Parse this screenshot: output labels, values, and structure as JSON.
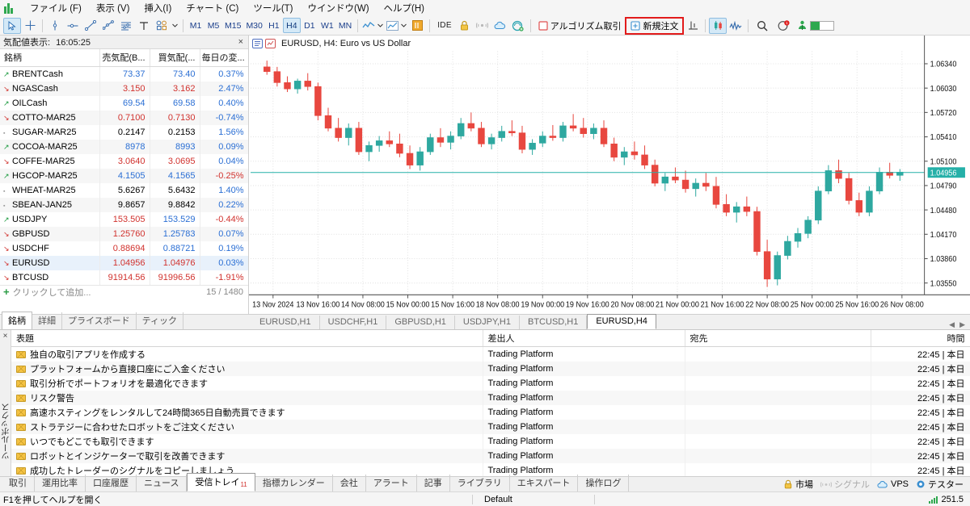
{
  "menu": {
    "items": [
      {
        "label": "ファイル (F)"
      },
      {
        "label": "表示 (V)"
      },
      {
        "label": "挿入(I)"
      },
      {
        "label": "チャート (C)"
      },
      {
        "label": "ツール(T)"
      },
      {
        "label": "ウインドウ(W)"
      },
      {
        "label": "ヘルプ(H)"
      }
    ]
  },
  "toolbar": {
    "timeframes": [
      "M1",
      "M5",
      "M15",
      "M30",
      "H1",
      "H4",
      "D1",
      "W1",
      "MN"
    ],
    "active_timeframe": "H4",
    "ide_label": "IDE",
    "algo_label": "アルゴリズム取引",
    "new_order_label": "新規注文",
    "highlight_color": "#e21b1b"
  },
  "market_watch": {
    "title": "気配値表示:",
    "time": "16:05:25",
    "columns": [
      "銘柄",
      "売気配(B...",
      "買気配(...",
      "毎日の変..."
    ],
    "rows": [
      {
        "trend": "up",
        "symbol": "BRENTCash",
        "bid": "73.37",
        "ask": "73.40",
        "chg": "0.37%",
        "bid_dir": "up",
        "ask_dir": "up",
        "chg_dir": "up"
      },
      {
        "trend": "down",
        "symbol": "NGASCash",
        "bid": "3.150",
        "ask": "3.162",
        "chg": "2.47%",
        "bid_dir": "down",
        "ask_dir": "down",
        "chg_dir": "up"
      },
      {
        "trend": "up",
        "symbol": "OILCash",
        "bid": "69.54",
        "ask": "69.58",
        "chg": "0.40%",
        "bid_dir": "up",
        "ask_dir": "up",
        "chg_dir": "up"
      },
      {
        "trend": "down",
        "symbol": "COTTO-MAR25",
        "bid": "0.7100",
        "ask": "0.7130",
        "chg": "-0.74%",
        "bid_dir": "down",
        "ask_dir": "down",
        "chg_dir": "up"
      },
      {
        "trend": "flat",
        "symbol": "SUGAR-MAR25",
        "bid": "0.2147",
        "ask": "0.2153",
        "chg": "1.56%",
        "bid_dir": "none",
        "ask_dir": "none",
        "chg_dir": "up"
      },
      {
        "trend": "up",
        "symbol": "COCOA-MAR25",
        "bid": "8978",
        "ask": "8993",
        "chg": "0.09%",
        "bid_dir": "up",
        "ask_dir": "up",
        "chg_dir": "up"
      },
      {
        "trend": "down",
        "symbol": "COFFE-MAR25",
        "bid": "3.0640",
        "ask": "3.0695",
        "chg": "0.04%",
        "bid_dir": "down",
        "ask_dir": "down",
        "chg_dir": "up"
      },
      {
        "trend": "up",
        "symbol": "HGCOP-MAR25",
        "bid": "4.1505",
        "ask": "4.1565",
        "chg": "-0.25%",
        "bid_dir": "up",
        "ask_dir": "up",
        "chg_dir": "down"
      },
      {
        "trend": "flat",
        "symbol": "WHEAT-MAR25",
        "bid": "5.6267",
        "ask": "5.6432",
        "chg": "1.40%",
        "bid_dir": "none",
        "ask_dir": "none",
        "chg_dir": "up"
      },
      {
        "trend": "flat",
        "symbol": "SBEAN-JAN25",
        "bid": "9.8657",
        "ask": "9.8842",
        "chg": "0.22%",
        "bid_dir": "none",
        "ask_dir": "none",
        "chg_dir": "up"
      },
      {
        "trend": "up",
        "symbol": "USDJPY",
        "bid": "153.505",
        "ask": "153.529",
        "chg": "-0.44%",
        "bid_dir": "down",
        "ask_dir": "up",
        "chg_dir": "down"
      },
      {
        "trend": "down",
        "symbol": "GBPUSD",
        "bid": "1.25760",
        "ask": "1.25783",
        "chg": "0.07%",
        "bid_dir": "down",
        "ask_dir": "up",
        "chg_dir": "up"
      },
      {
        "trend": "down",
        "symbol": "USDCHF",
        "bid": "0.88694",
        "ask": "0.88721",
        "chg": "0.19%",
        "bid_dir": "down",
        "ask_dir": "up",
        "chg_dir": "up"
      },
      {
        "trend": "down",
        "symbol": "EURUSD",
        "bid": "1.04956",
        "ask": "1.04976",
        "chg": "0.03%",
        "bid_dir": "down",
        "ask_dir": "down",
        "chg_dir": "up"
      },
      {
        "trend": "down",
        "symbol": "BTCUSD",
        "bid": "91914.56",
        "ask": "91996.56",
        "chg": "-1.91%",
        "bid_dir": "down",
        "ask_dir": "down",
        "chg_dir": "down"
      }
    ],
    "add_label": "クリックして追加...",
    "count_label": "15 / 1480",
    "tabs": [
      "銘柄",
      "詳細",
      "プライスボード",
      "ティック"
    ],
    "active_tab": "銘柄"
  },
  "chart": {
    "title": "EURUSD, H4:  Euro vs US Dollar",
    "current_price": "1.04956",
    "price_label_color": "#25b0a8",
    "tabs": [
      "EURUSD,H1",
      "USDCHF,H1",
      "GBPUSD,H1",
      "USDJPY,H1",
      "BTCUSD,H1",
      "EURUSD,H4"
    ],
    "active_tab": "EURUSD,H4"
  },
  "chart_data": {
    "type": "line",
    "title": "EURUSD, H4: Euro vs US Dollar",
    "xlabel": "",
    "ylabel": "",
    "grid": true,
    "ylim": [
      1.034,
      1.065
    ],
    "y_ticks": [
      "1.06340",
      "1.06030",
      "1.05720",
      "1.05410",
      "1.05100",
      "1.04790",
      "1.04480",
      "1.04170",
      "1.03860",
      "1.03550"
    ],
    "x_ticks": [
      "13 Nov 2024",
      "13 Nov 16:00",
      "14 Nov 08:00",
      "15 Nov 00:00",
      "15 Nov 16:00",
      "18 Nov 08:00",
      "19 Nov 00:00",
      "19 Nov 16:00",
      "20 Nov 08:00",
      "21 Nov 00:00",
      "21 Nov 16:00",
      "22 Nov 08:00",
      "25 Nov 00:00",
      "25 Nov 16:00",
      "26 Nov 08:00"
    ],
    "current_price_line": 1.04956,
    "bull_color": "#2ea8a0",
    "bear_color": "#e8473f",
    "candles": [
      {
        "o": 1.063,
        "h": 1.0638,
        "l": 1.062,
        "c": 1.0624
      },
      {
        "o": 1.0624,
        "h": 1.063,
        "l": 1.0605,
        "c": 1.061
      },
      {
        "o": 1.061,
        "h": 1.0618,
        "l": 1.0598,
        "c": 1.0602
      },
      {
        "o": 1.0602,
        "h": 1.0615,
        "l": 1.0596,
        "c": 1.0612
      },
      {
        "o": 1.0612,
        "h": 1.0622,
        "l": 1.06,
        "c": 1.0605
      },
      {
        "o": 1.0605,
        "h": 1.061,
        "l": 1.0562,
        "c": 1.0568
      },
      {
        "o": 1.0568,
        "h": 1.0578,
        "l": 1.0548,
        "c": 1.0552
      },
      {
        "o": 1.0552,
        "h": 1.0565,
        "l": 1.0535,
        "c": 1.054
      },
      {
        "o": 1.054,
        "h": 1.0558,
        "l": 1.053,
        "c": 1.0552
      },
      {
        "o": 1.0552,
        "h": 1.056,
        "l": 1.0518,
        "c": 1.0522
      },
      {
        "o": 1.0522,
        "h": 1.0535,
        "l": 1.051,
        "c": 1.053
      },
      {
        "o": 1.053,
        "h": 1.0542,
        "l": 1.0522,
        "c": 1.0536
      },
      {
        "o": 1.0536,
        "h": 1.0548,
        "l": 1.0528,
        "c": 1.0532
      },
      {
        "o": 1.0532,
        "h": 1.0545,
        "l": 1.0515,
        "c": 1.052
      },
      {
        "o": 1.052,
        "h": 1.053,
        "l": 1.05,
        "c": 1.0505
      },
      {
        "o": 1.0505,
        "h": 1.0528,
        "l": 1.0498,
        "c": 1.0522
      },
      {
        "o": 1.0522,
        "h": 1.0545,
        "l": 1.0518,
        "c": 1.054
      },
      {
        "o": 1.054,
        "h": 1.0552,
        "l": 1.0528,
        "c": 1.0534
      },
      {
        "o": 1.0534,
        "h": 1.0548,
        "l": 1.0525,
        "c": 1.0542
      },
      {
        "o": 1.0542,
        "h": 1.0565,
        "l": 1.0538,
        "c": 1.0558
      },
      {
        "o": 1.0558,
        "h": 1.0572,
        "l": 1.0548,
        "c": 1.0552
      },
      {
        "o": 1.0552,
        "h": 1.056,
        "l": 1.0528,
        "c": 1.0532
      },
      {
        "o": 1.0532,
        "h": 1.0545,
        "l": 1.0525,
        "c": 1.054
      },
      {
        "o": 1.054,
        "h": 1.0555,
        "l": 1.0535,
        "c": 1.0548
      },
      {
        "o": 1.0548,
        "h": 1.0562,
        "l": 1.0542,
        "c": 1.0546
      },
      {
        "o": 1.0546,
        "h": 1.0555,
        "l": 1.052,
        "c": 1.0525
      },
      {
        "o": 1.0525,
        "h": 1.0538,
        "l": 1.0518,
        "c": 1.0533
      },
      {
        "o": 1.0533,
        "h": 1.0548,
        "l": 1.0528,
        "c": 1.0542
      },
      {
        "o": 1.0542,
        "h": 1.0556,
        "l": 1.0536,
        "c": 1.054
      },
      {
        "o": 1.054,
        "h": 1.056,
        "l": 1.0535,
        "c": 1.0555
      },
      {
        "o": 1.0555,
        "h": 1.057,
        "l": 1.0548,
        "c": 1.0552
      },
      {
        "o": 1.0552,
        "h": 1.0565,
        "l": 1.054,
        "c": 1.0545
      },
      {
        "o": 1.0545,
        "h": 1.0558,
        "l": 1.0538,
        "c": 1.0552
      },
      {
        "o": 1.0552,
        "h": 1.0562,
        "l": 1.0528,
        "c": 1.0532
      },
      {
        "o": 1.0532,
        "h": 1.054,
        "l": 1.051,
        "c": 1.0515
      },
      {
        "o": 1.0515,
        "h": 1.0528,
        "l": 1.0505,
        "c": 1.0522
      },
      {
        "o": 1.0522,
        "h": 1.0535,
        "l": 1.0512,
        "c": 1.0518
      },
      {
        "o": 1.0518,
        "h": 1.053,
        "l": 1.05,
        "c": 1.0505
      },
      {
        "o": 1.0505,
        "h": 1.0512,
        "l": 1.0478,
        "c": 1.0482
      },
      {
        "o": 1.0482,
        "h": 1.0495,
        "l": 1.0472,
        "c": 1.049
      },
      {
        "o": 1.049,
        "h": 1.0502,
        "l": 1.0482,
        "c": 1.0486
      },
      {
        "o": 1.0486,
        "h": 1.0498,
        "l": 1.047,
        "c": 1.0475
      },
      {
        "o": 1.0475,
        "h": 1.0488,
        "l": 1.0465,
        "c": 1.0482
      },
      {
        "o": 1.0482,
        "h": 1.0495,
        "l": 1.0472,
        "c": 1.0478
      },
      {
        "o": 1.0478,
        "h": 1.049,
        "l": 1.045,
        "c": 1.0455
      },
      {
        "o": 1.0455,
        "h": 1.0468,
        "l": 1.044,
        "c": 1.0445
      },
      {
        "o": 1.0445,
        "h": 1.0458,
        "l": 1.0432,
        "c": 1.0452
      },
      {
        "o": 1.0452,
        "h": 1.0465,
        "l": 1.044,
        "c": 1.0446
      },
      {
        "o": 1.0446,
        "h": 1.0452,
        "l": 1.039,
        "c": 1.0395
      },
      {
        "o": 1.0395,
        "h": 1.041,
        "l": 1.035,
        "c": 1.036
      },
      {
        "o": 1.036,
        "h": 1.0395,
        "l": 1.0352,
        "c": 1.039
      },
      {
        "o": 1.039,
        "h": 1.0415,
        "l": 1.0385,
        "c": 1.0408
      },
      {
        "o": 1.0408,
        "h": 1.0425,
        "l": 1.04,
        "c": 1.0418
      },
      {
        "o": 1.0418,
        "h": 1.044,
        "l": 1.0412,
        "c": 1.0435
      },
      {
        "o": 1.0435,
        "h": 1.0478,
        "l": 1.043,
        "c": 1.0472
      },
      {
        "o": 1.0472,
        "h": 1.0505,
        "l": 1.0468,
        "c": 1.0498
      },
      {
        "o": 1.0498,
        "h": 1.0512,
        "l": 1.0482,
        "c": 1.0488
      },
      {
        "o": 1.0488,
        "h": 1.0495,
        "l": 1.0455,
        "c": 1.046
      },
      {
        "o": 1.046,
        "h": 1.047,
        "l": 1.044,
        "c": 1.0445
      },
      {
        "o": 1.0445,
        "h": 1.0478,
        "l": 1.044,
        "c": 1.0472
      },
      {
        "o": 1.0472,
        "h": 1.0502,
        "l": 1.0468,
        "c": 1.0496
      },
      {
        "o": 1.0496,
        "h": 1.0508,
        "l": 1.0488,
        "c": 1.0492
      },
      {
        "o": 1.0492,
        "h": 1.05,
        "l": 1.0485,
        "c": 1.0496
      }
    ]
  },
  "news": {
    "columns": [
      "表題",
      "差出人",
      "宛先",
      "時間"
    ],
    "rows": [
      {
        "subject": "独自の取引アプリを作成する",
        "from": "Trading Platform",
        "to": "",
        "time": "22:45 | 本日"
      },
      {
        "subject": "プラットフォームから直接口座にご入金ください",
        "from": "Trading Platform",
        "to": "",
        "time": "22:45 | 本日"
      },
      {
        "subject": "取引分析でポートフォリオを最適化できます",
        "from": "Trading Platform",
        "to": "",
        "time": "22:45 | 本日"
      },
      {
        "subject": "リスク警告",
        "from": "Trading Platform",
        "to": "",
        "time": "22:45 | 本日"
      },
      {
        "subject": "高速ホスティングをレンタルして24時間365日自動売買できます",
        "from": "Trading Platform",
        "to": "",
        "time": "22:45 | 本日"
      },
      {
        "subject": "ストラテジーに合わせたロボットをご注文ください",
        "from": "Trading Platform",
        "to": "",
        "time": "22:45 | 本日"
      },
      {
        "subject": "いつでもどこでも取引できます",
        "from": "Trading Platform",
        "to": "",
        "time": "22:45 | 本日"
      },
      {
        "subject": "ロボットとインジケーターで取引を改善できます",
        "from": "Trading Platform",
        "to": "",
        "time": "22:45 | 本日"
      },
      {
        "subject": "成功したトレーダーのシグナルをコピーしましょう",
        "from": "Trading Platform",
        "to": "",
        "time": "22:45 | 本日"
      }
    ],
    "rail_label": "ツールボックス"
  },
  "bottom": {
    "tabs": [
      "取引",
      "運用比率",
      "口座履歴",
      "ニュース",
      "受信トレイ",
      "指標カレンダー",
      "会社",
      "アラート",
      "記事",
      "ライブラリ",
      "エキスパート",
      "操作ログ"
    ],
    "active_tab": "受信トレイ",
    "inbox_badge": "11",
    "right_items": [
      {
        "label": "市場",
        "icon": "lock-icon",
        "dim": false
      },
      {
        "label": "シグナル",
        "icon": "signal-icon",
        "dim": true
      },
      {
        "label": "VPS",
        "icon": "cloud-icon",
        "dim": false
      },
      {
        "label": "テスター",
        "icon": "gear-icon",
        "dim": false
      }
    ]
  },
  "status": {
    "help_text": "F1を押してヘルプを開く",
    "profile": "Default",
    "network": "251.5"
  }
}
